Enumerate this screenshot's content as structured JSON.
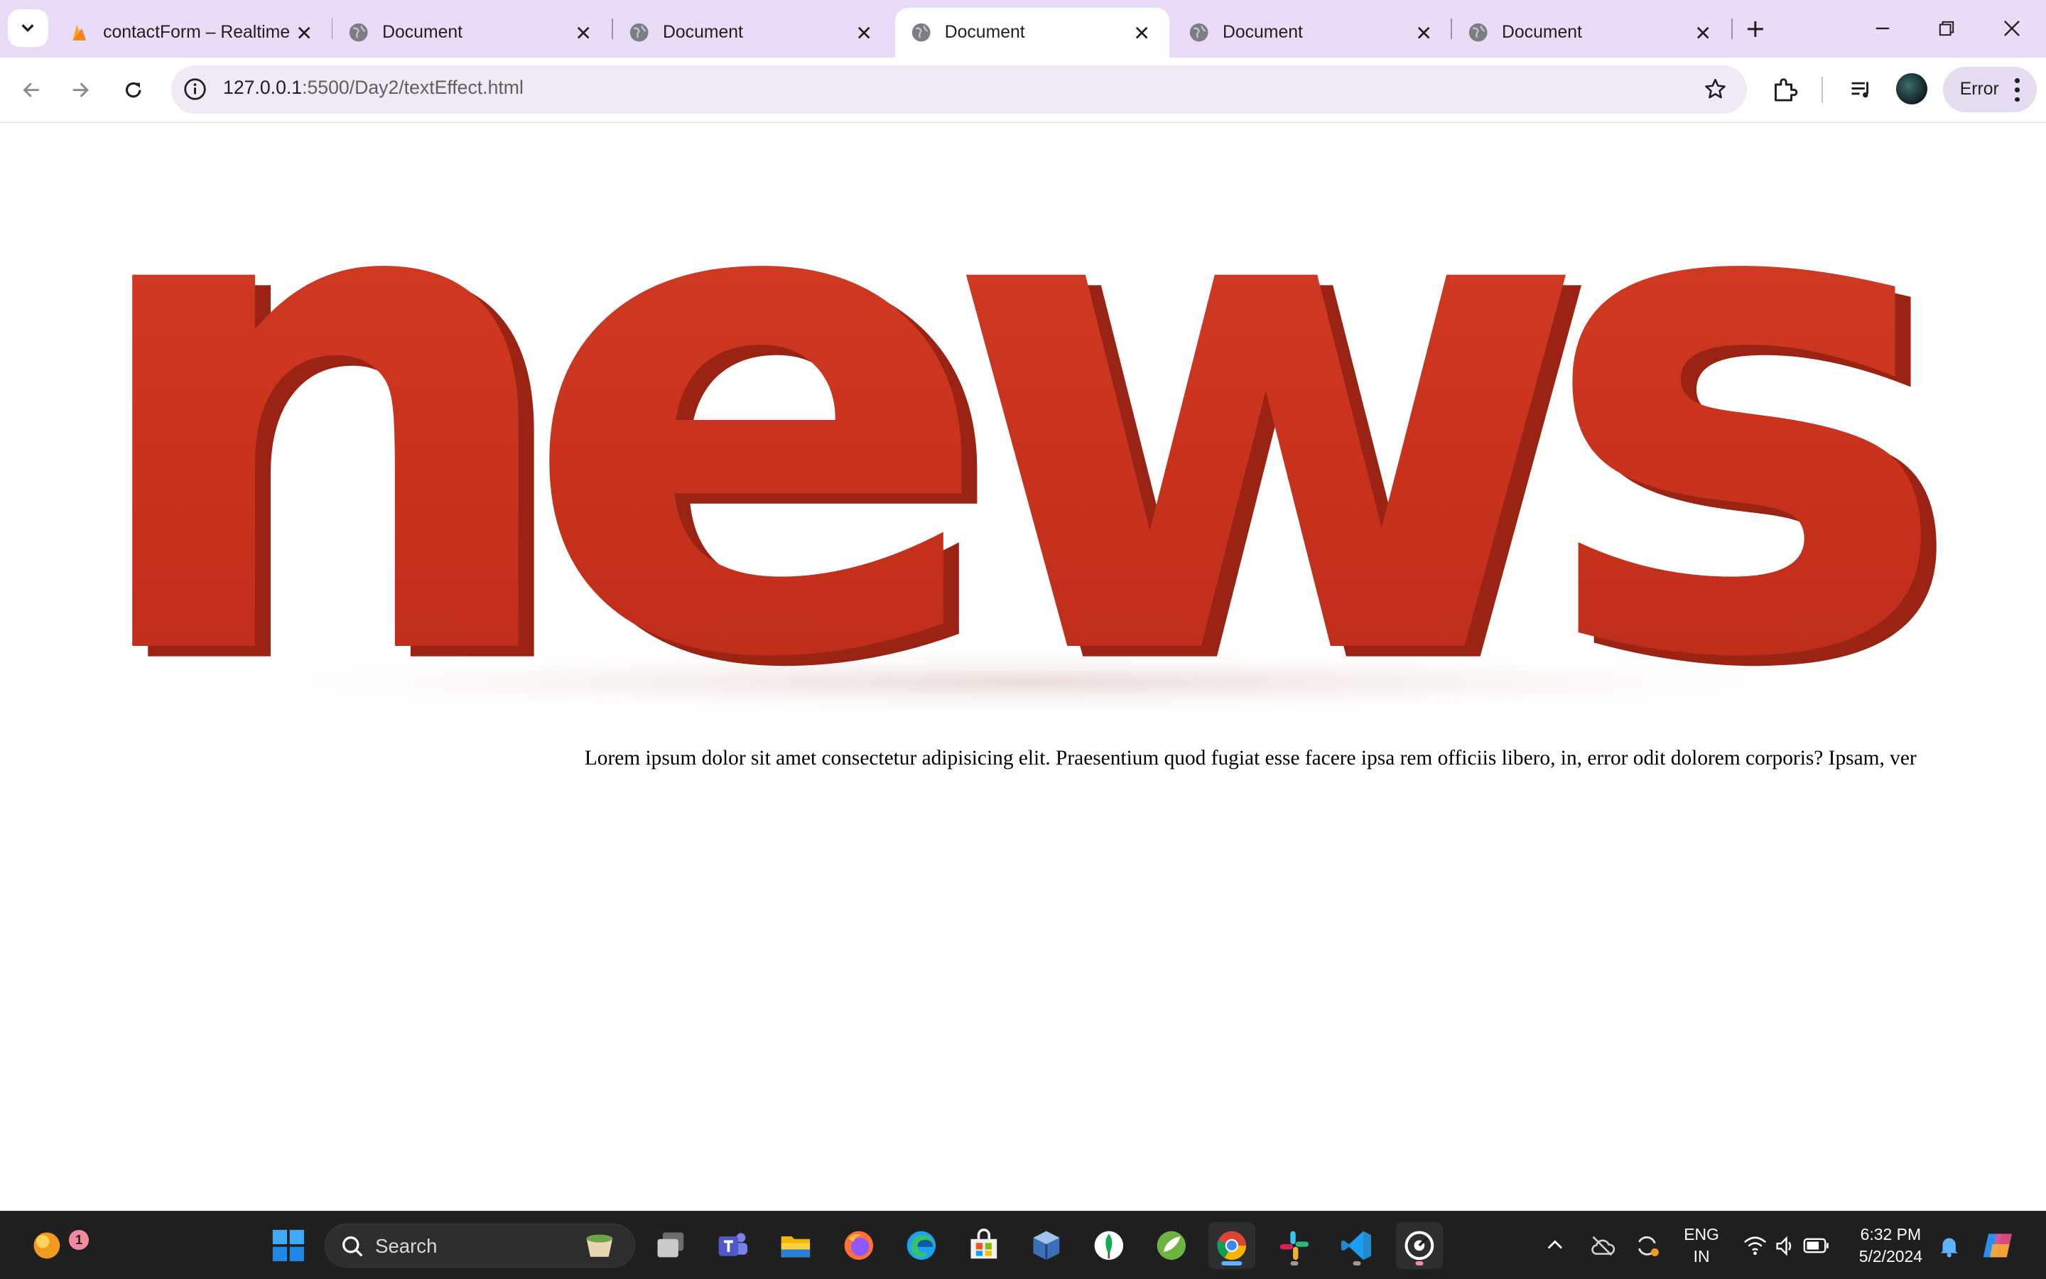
{
  "browser": {
    "tabs": [
      {
        "title": "contactForm – Realtime",
        "favicon": "firebase-icon",
        "active": false
      },
      {
        "title": "Document",
        "favicon": "globe-icon",
        "active": false
      },
      {
        "title": "Document",
        "favicon": "globe-icon",
        "active": false
      },
      {
        "title": "Document",
        "favicon": "globe-icon",
        "active": true
      },
      {
        "title": "Document",
        "favicon": "globe-icon",
        "active": false
      },
      {
        "title": "Document",
        "favicon": "globe-icon",
        "active": false
      }
    ],
    "url_host": "127.0.0.1",
    "url_path": ":5500/Day2/textEffect.html",
    "profile_label": "Error",
    "accent": "#e9dcf6"
  },
  "page": {
    "hero_word": "news",
    "hero_color": "#d13a22",
    "paragraph": "Lorem ipsum dolor sit amet consectetur adipisicing elit. Praesentium quod fugiat esse facere ipsa rem officiis libero, in, error odit dolorem corporis? Ipsam, ver"
  },
  "taskbar": {
    "search_label": "Search",
    "weather_badge": "1",
    "language_top": "ENG",
    "language_bottom": "IN",
    "time": "6:32 PM",
    "date": "5/2/2024",
    "apps": [
      "widgets-icon",
      "windows-start-icon",
      "search-icon",
      "task-view-icon",
      "teams-icon",
      "file-explorer-icon",
      "firefox-icon",
      "edge-icon",
      "microsoft-store-icon",
      "virtualbox-icon",
      "mongodb-icon",
      "spring-icon",
      "chrome-icon",
      "slack-icon",
      "vscode-icon",
      "screen-recorder-icon"
    ]
  }
}
